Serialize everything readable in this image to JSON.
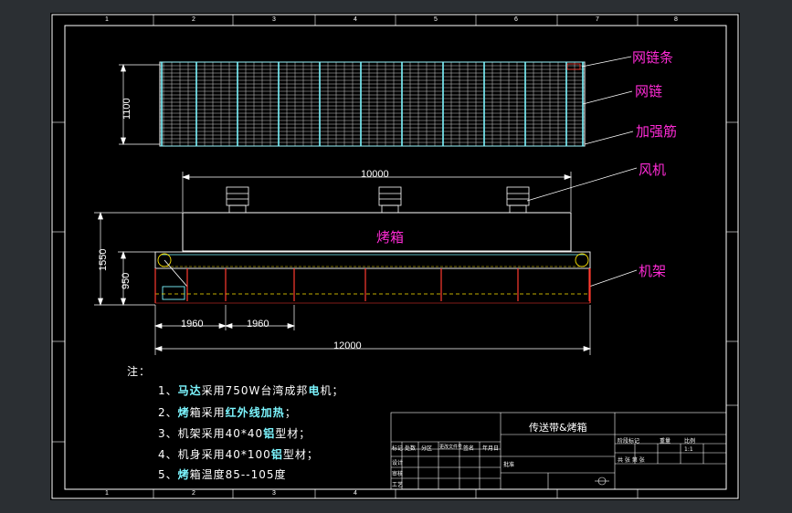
{
  "labels": {
    "mesh_belt_strip": "网链条",
    "mesh_chain": "网链",
    "stiffener": "加强筋",
    "fan": "风机",
    "frame": "机架",
    "oven": "烤箱"
  },
  "dimensions": {
    "width_1100": "1100",
    "oven_length": "10000",
    "total_height": "1550",
    "frame_height": "950",
    "spacing_a": "1960",
    "spacing_b": "1960",
    "total_length": "12000"
  },
  "notes": {
    "heading": "注：",
    "n1_prefix": "1、",
    "n1_hl": "马达",
    "n1_mid": "采用750W台湾成邦",
    "n1_hl2": "电",
    "n1_end": "机；",
    "n2_prefix": "2、",
    "n2_hl": "烤",
    "n2_mid": "箱采用",
    "n2_hl2": "红外线加热",
    "n2_end": "；",
    "n3_prefix": "3、",
    "n3_mid": "机架采用40*40",
    "n3_hl": "铝",
    "n3_end": "型材；",
    "n4_prefix": "4、",
    "n4_mid": "机身采用40*100",
    "n4_hl": "铝",
    "n4_end": "型材；",
    "n5_prefix": "5、",
    "n5_hl": "烤",
    "n5_end": "箱温度85--105度"
  },
  "title_block": {
    "drawing_title": "传送带&烤箱",
    "row_marks": [
      "标记",
      "处数",
      "分区",
      "更改文件号",
      "签名",
      "年月日"
    ],
    "design": "设计",
    "check": "审核",
    "craft": "工艺",
    "approve": "批准",
    "stage": "阶段标记",
    "weight": "重量",
    "scale": "比例",
    "sheet": "共 张 第 张",
    "scale_value": "1:1"
  },
  "grid_numbers": [
    "1",
    "2",
    "3",
    "4",
    "5",
    "6",
    "7",
    "8"
  ],
  "colors": {
    "background": "#2b2f33",
    "sheet": "#000000",
    "lines": "#ffffff",
    "label": "#ff2bd6",
    "frame_red": "#ff3b30",
    "cyan": "#7cf6ff",
    "yellow": "#ffe600"
  }
}
